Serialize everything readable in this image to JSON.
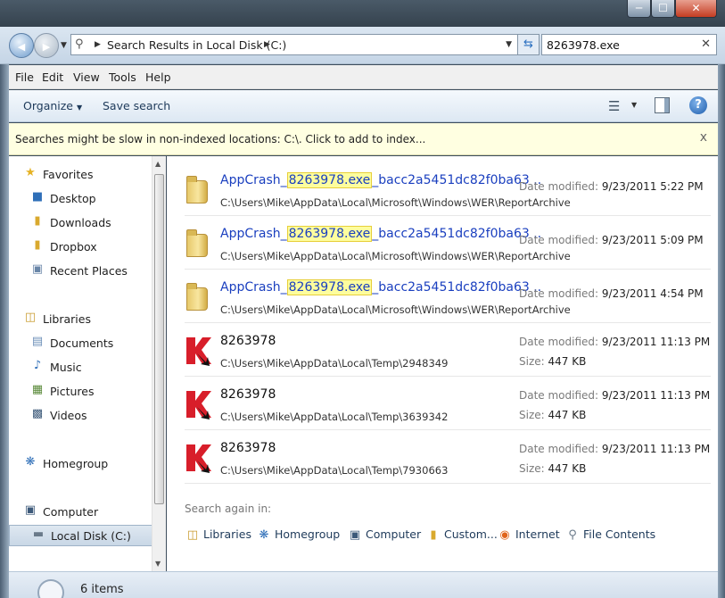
{
  "window": {
    "minimize": "─",
    "maximize": "☐",
    "close": "✕"
  },
  "nav": {
    "back": "◀",
    "forward": "▶",
    "address_sep": "▶",
    "address": "Search Results in Local Disk (C:)",
    "search_value": "8263978.exe",
    "search_clear": "✕"
  },
  "menu": [
    "File",
    "Edit",
    "View",
    "Tools",
    "Help"
  ],
  "toolbar": {
    "organize": "Organize",
    "save_search": "Save search"
  },
  "infobar": {
    "text": "Searches might be slow in non-indexed locations: C:\\. Click to add to index...",
    "close": "x"
  },
  "sidebar": {
    "favorites": {
      "label": "Favorites",
      "items": [
        "Desktop",
        "Downloads",
        "Dropbox",
        "Recent Places"
      ]
    },
    "libraries": {
      "label": "Libraries",
      "items": [
        "Documents",
        "Music",
        "Pictures",
        "Videos"
      ]
    },
    "homegroup": "Homegroup",
    "computer": {
      "label": "Computer",
      "items": [
        "Local Disk (C:)"
      ]
    }
  },
  "results": [
    {
      "name_prefix": "AppCrash_",
      "name_match": "8263978.exe",
      "name_suffix": "_bacc2a5451dc82f0ba63 ..",
      "path": "C:\\Users\\Mike\\AppData\\Local\\Microsoft\\Windows\\WER\\ReportArchive",
      "date_label": "Date modified:",
      "date": "9/23/2011 5:22 PM"
    },
    {
      "name_prefix": "AppCrash_",
      "name_match": "8263978.exe",
      "name_suffix": "_bacc2a5451dc82f0ba63 ..",
      "path": "C:\\Users\\Mike\\AppData\\Local\\Microsoft\\Windows\\WER\\ReportArchive",
      "date_label": "Date modified:",
      "date": "9/23/2011 5:09 PM"
    },
    {
      "name_prefix": "AppCrash_",
      "name_match": "8263978.exe",
      "name_suffix": "_bacc2a5451dc82f0ba63 ..",
      "path": "C:\\Users\\Mike\\AppData\\Local\\Microsoft\\Windows\\WER\\ReportArchive",
      "date_label": "Date modified:",
      "date": "9/23/2011 4:54 PM"
    },
    {
      "name": "8263978",
      "path": "C:\\Users\\Mike\\AppData\\Local\\Temp\\2948349",
      "date_label": "Date modified:",
      "date": "9/23/2011 11:13 PM",
      "size_label": "Size:",
      "size": "447 KB"
    },
    {
      "name": "8263978",
      "path": "C:\\Users\\Mike\\AppData\\Local\\Temp\\3639342",
      "date_label": "Date modified:",
      "date": "9/23/2011 11:13 PM",
      "size_label": "Size:",
      "size": "447 KB"
    },
    {
      "name": "8263978",
      "path": "C:\\Users\\Mike\\AppData\\Local\\Temp\\7930663",
      "date_label": "Date modified:",
      "date": "9/23/2011 11:13 PM",
      "size_label": "Size:",
      "size": "447 KB"
    }
  ],
  "search_again": {
    "label": "Search again in:",
    "options": [
      "Libraries",
      "Homegroup",
      "Computer",
      "Custom...",
      "Internet",
      "File Contents"
    ]
  },
  "status": {
    "count": "6 items"
  },
  "colors": {
    "link": "#1a3fbf",
    "highlight": "#fdfd9e",
    "infobar": "#ffffe1"
  },
  "icons": {
    "folder": "folder-icon",
    "exe": "kaspersky-app-icon"
  }
}
